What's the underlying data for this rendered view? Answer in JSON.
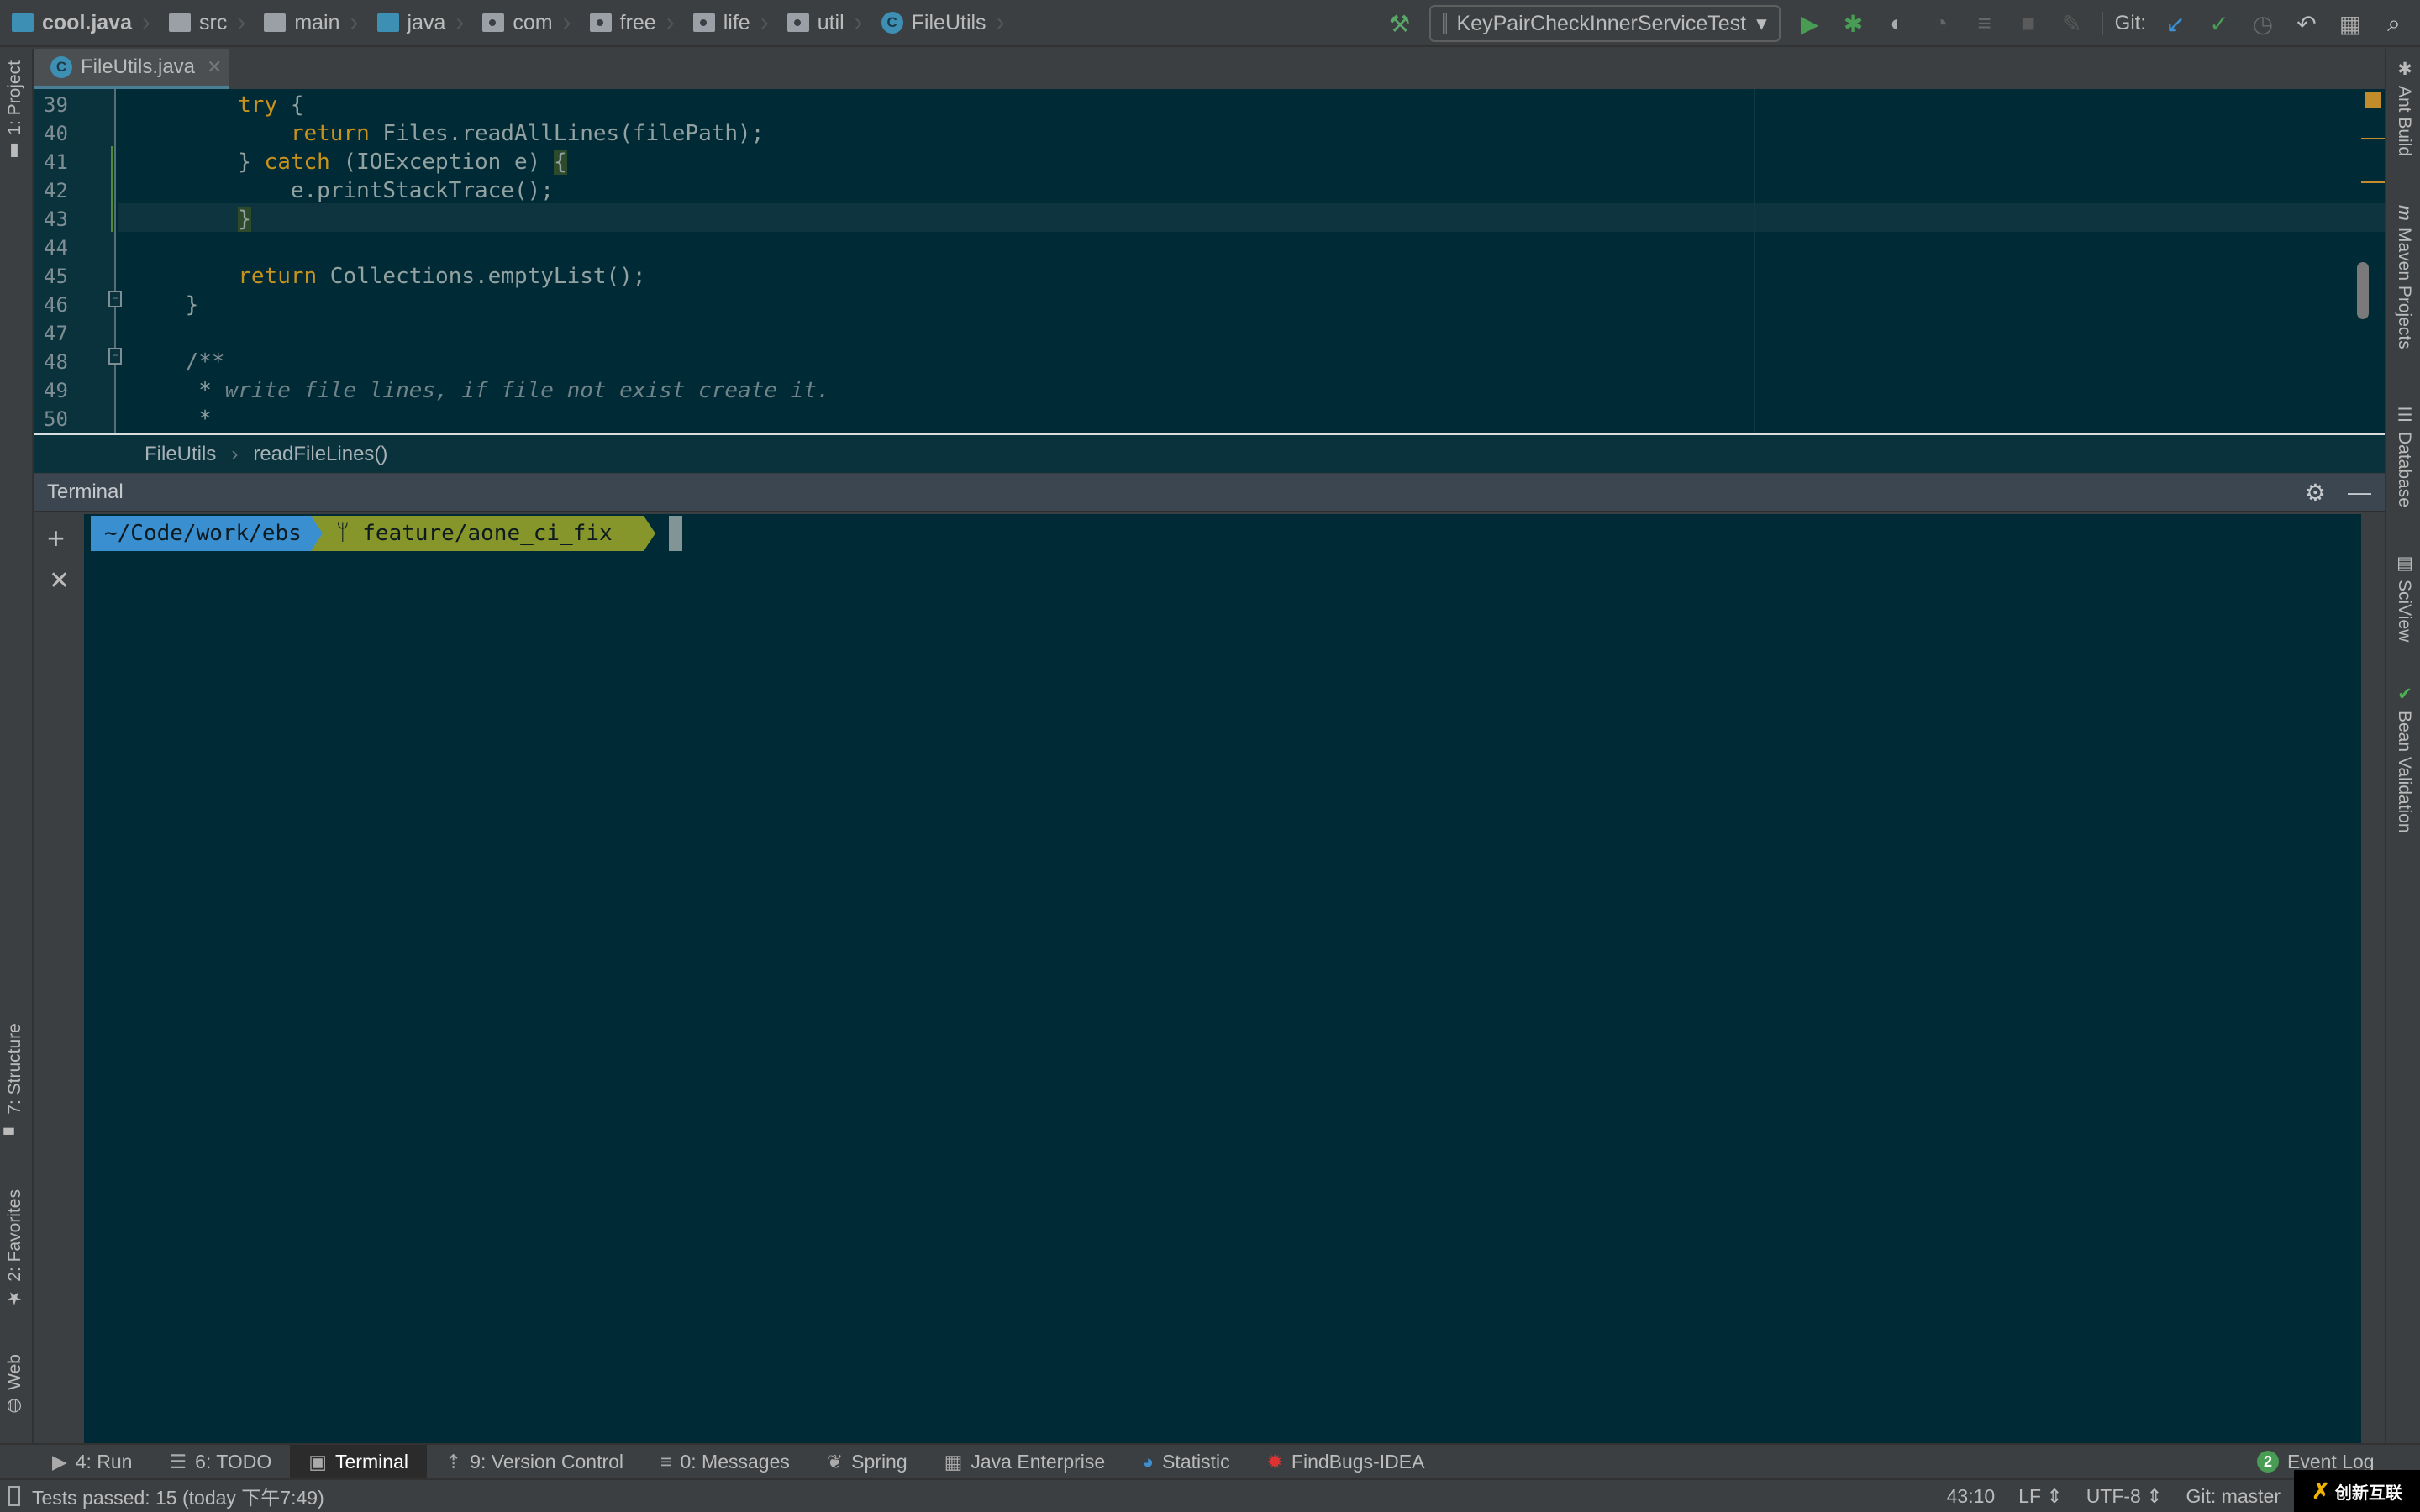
{
  "navbar": {
    "crumbs": [
      {
        "label": "cool.java",
        "icon": "module-folder-icon"
      },
      {
        "label": "src",
        "icon": "folder-icon"
      },
      {
        "label": "main",
        "icon": "folder-icon"
      },
      {
        "label": "java",
        "icon": "source-folder-icon"
      },
      {
        "label": "com",
        "icon": "package-icon"
      },
      {
        "label": "free",
        "icon": "package-icon"
      },
      {
        "label": "life",
        "icon": "package-icon"
      },
      {
        "label": "util",
        "icon": "package-icon"
      },
      {
        "label": "FileUtils",
        "icon": "class-icon"
      }
    ]
  },
  "toolbar": {
    "run_config": "KeyPairCheckInnerServiceTest",
    "git_label": "Git:"
  },
  "tabs": [
    {
      "label": "FileUtils.java",
      "icon_letter": "C"
    }
  ],
  "editor": {
    "lines": [
      {
        "n": "39",
        "code": [
          {
            "t": "        "
          },
          {
            "t": "try",
            "k": "kw"
          },
          {
            "t": " {"
          }
        ]
      },
      {
        "n": "40",
        "code": [
          {
            "t": "            "
          },
          {
            "t": "return",
            "k": "kw"
          },
          {
            "t": " Files.readAllLines(filePath);"
          }
        ]
      },
      {
        "n": "41",
        "code": [
          {
            "t": "        } "
          },
          {
            "t": "catch",
            "k": "kw"
          },
          {
            "t": " (IOException e) "
          },
          {
            "t": "{",
            "k": "br"
          }
        ]
      },
      {
        "n": "42",
        "code": [
          {
            "t": "            e.printStackTrace();"
          }
        ]
      },
      {
        "n": "43",
        "code": [
          {
            "t": "        "
          },
          {
            "t": "}",
            "k": "br"
          }
        ]
      },
      {
        "n": "44",
        "code": []
      },
      {
        "n": "45",
        "code": [
          {
            "t": "        "
          },
          {
            "t": "return",
            "k": "kw"
          },
          {
            "t": " Collections.emptyList();"
          }
        ]
      },
      {
        "n": "46",
        "code": [
          {
            "t": "    }"
          }
        ]
      },
      {
        "n": "47",
        "code": []
      },
      {
        "n": "48",
        "code": [
          {
            "t": "    /**",
            "k": "cmn"
          }
        ]
      },
      {
        "n": "49",
        "code": [
          {
            "t": "     * "
          },
          {
            "t": "write file lines, if file not exist create it.",
            "k": "cm"
          }
        ]
      },
      {
        "n": "50",
        "code": [
          {
            "t": "     *"
          }
        ]
      }
    ],
    "current_line": "43",
    "breadcrumb": [
      "FileUtils",
      "readFileLines()"
    ]
  },
  "left_strip": [
    "1: Project",
    "7: Structure",
    "2: Favorites",
    "Web"
  ],
  "right_strip": [
    "Ant Build",
    "Maven Projects",
    "Database",
    "SciView",
    "Bean Validation"
  ],
  "terminal": {
    "title": "Terminal",
    "path": "~/Code/work/ebs",
    "branch": "feature/aone_ci_fix",
    "path_color": "#3a8fd0",
    "branch_color": "#87962a"
  },
  "bottom_tools": [
    {
      "label": "4: Run",
      "icon": "run-icon"
    },
    {
      "label": "6: TODO",
      "icon": "todo-icon"
    },
    {
      "label": "Terminal",
      "icon": "terminal-icon",
      "active": true
    },
    {
      "label": "9: Version Control",
      "icon": "version-control-icon"
    },
    {
      "label": "0: Messages",
      "icon": "messages-icon"
    },
    {
      "label": "Spring",
      "icon": "spring-icon"
    },
    {
      "label": "Java Enterprise",
      "icon": "java-enterprise-icon"
    },
    {
      "label": "Statistic",
      "icon": "statistic-icon"
    },
    {
      "label": "FindBugs-IDEA",
      "icon": "findbugs-icon"
    }
  ],
  "event_log": {
    "label": "Event Log",
    "count": "2"
  },
  "status": {
    "message": "Tests passed: 15 (today 下午7:49)",
    "position": "43:10",
    "line_sep": "LF",
    "encoding": "UTF-8",
    "git": "Git: master"
  },
  "watermark": {
    "text": "创新互联"
  }
}
